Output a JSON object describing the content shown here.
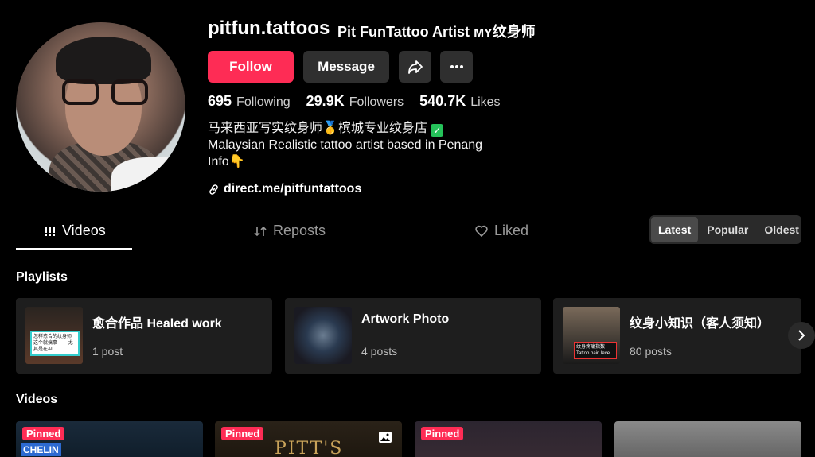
{
  "profile": {
    "username": "pitfun.tattoos",
    "nickname": "Pit FunTattoo Artist ᴍʏ纹身师",
    "follow_label": "Follow",
    "message_label": "Message",
    "stats": {
      "following_count": "695",
      "following_label": "Following",
      "followers_count": "29.9K",
      "followers_label": "Followers",
      "likes_count": "540.7K",
      "likes_label": "Likes"
    },
    "bio_line1": "马来西亚写实纹身师",
    "bio_line1b": "槟城专业纹身店",
    "bio_line2": "Malaysian Realistic tattoo artist based in Penang",
    "bio_line3": "Info",
    "link": "direct.me/pitfuntattoos"
  },
  "tabs": {
    "videos": "Videos",
    "reposts": "Reposts",
    "liked": "Liked"
  },
  "sort": {
    "latest": "Latest",
    "popular": "Popular",
    "oldest": "Oldest"
  },
  "sections": {
    "playlists": "Playlists",
    "videos": "Videos"
  },
  "playlists": [
    {
      "name": "愈合作品 Healed work",
      "count": "1 post",
      "thumb_text": "怎样愈合的纹身师 这个就搞事—— 尤其是在AI"
    },
    {
      "name": "Artwork Photo",
      "count": "4 posts"
    },
    {
      "name": "纹身小知识（客人须知）",
      "count": "80 posts",
      "thumb_text": "纹身疼痛指数 Tattoo pain level"
    }
  ],
  "videos": [
    {
      "badge": "Pinned",
      "text": "CHELIN"
    },
    {
      "badge": "Pinned",
      "text": "PITT'S"
    },
    {
      "badge": "Pinned"
    },
    {}
  ],
  "colors": {
    "accent": "#fe2c55",
    "button_bg": "#2f2f2f",
    "verified": "#25c25a"
  }
}
